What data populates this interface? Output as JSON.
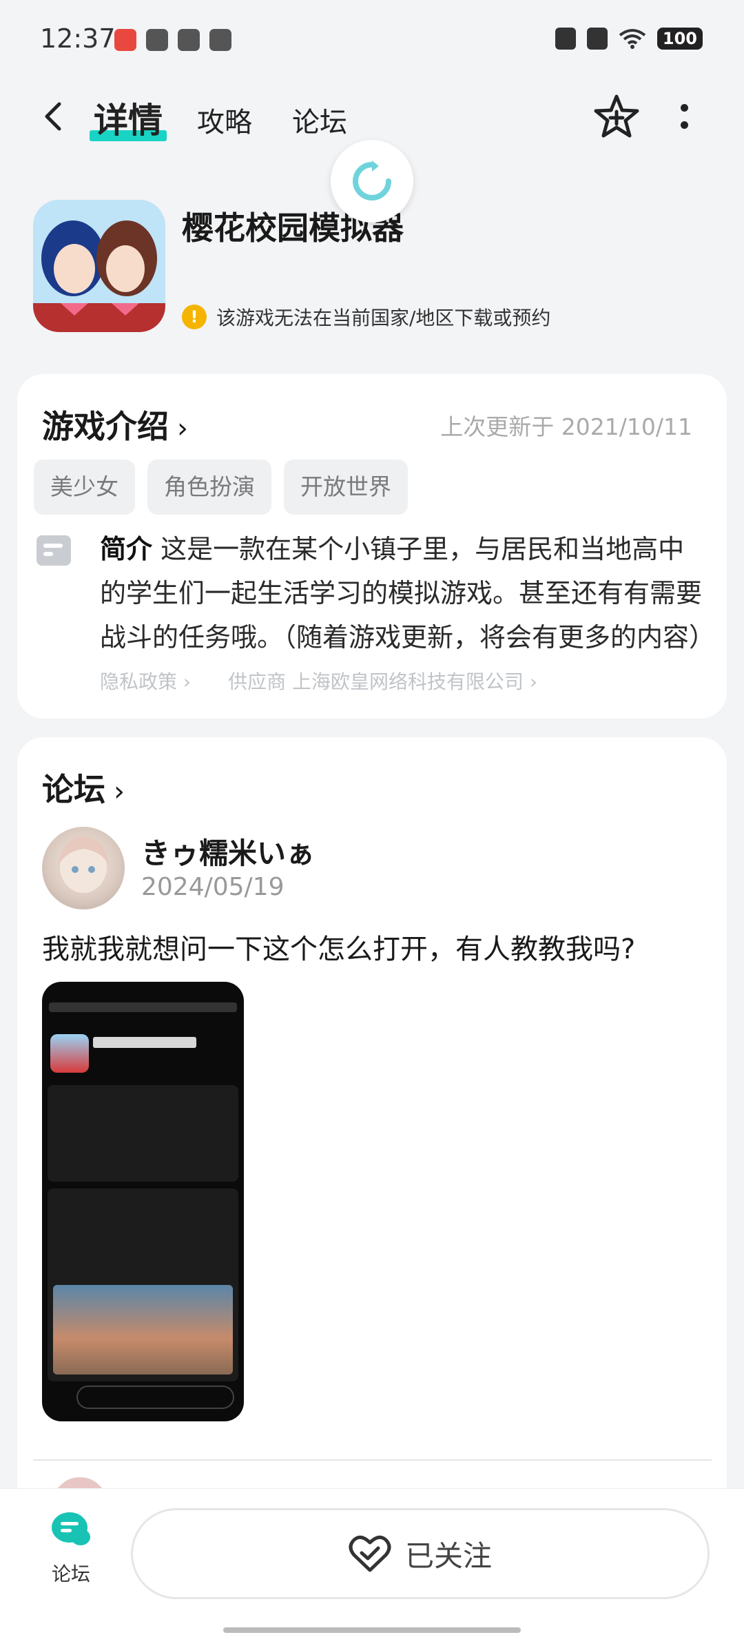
{
  "status_bar": {
    "time": "12:37",
    "battery": "100",
    "icons": [
      "app-icon-red",
      "app-icon-bear",
      "app-icon-leaf",
      "app-icon-message",
      "mute-icon",
      "x-icon",
      "wifi-icon",
      "battery-icon"
    ]
  },
  "nav": {
    "tabs": [
      {
        "label": "详情",
        "active": true
      },
      {
        "label": "攻略",
        "active": false
      },
      {
        "label": "论坛",
        "active": false
      }
    ],
    "icons": {
      "back": "back-arrow-icon",
      "favorite": "star-plus-icon",
      "more": "more-vertical-icon",
      "refresh": "refresh-icon"
    }
  },
  "app": {
    "title": "樱花校园模拟器",
    "notice": "该游戏无法在当前国家/地区下载或预约",
    "notice_icon": "info-icon"
  },
  "intro": {
    "title": "游戏介绍",
    "chevron": "›",
    "updated": "上次更新于 2021/10/11",
    "tags": [
      "美少女",
      "角色扮演",
      "开放世界"
    ],
    "desc_label": "简介",
    "desc_text": "这是一款在某个小镇子里，与居民和当地高中的学生们一起生活学习的模拟游戏。甚至还有有需要战斗的任务哦。（随着游戏更新，将会有更多的内容）",
    "privacy": "隐私政策 ›",
    "supplier": "供应商 上海欧皇网络科技有限公司 ›"
  },
  "forum": {
    "title": "论坛",
    "chevron": "›",
    "post": {
      "user": "きゥ糯米いぁ",
      "date": "2024/05/19",
      "text": "我就我就想问一下这个怎么打开，有人教教我吗?"
    }
  },
  "bottom": {
    "forum_label": "论坛",
    "follow_label": "已关注"
  },
  "colors": {
    "accent": "#19d3c5",
    "notice": "#f5b400"
  }
}
